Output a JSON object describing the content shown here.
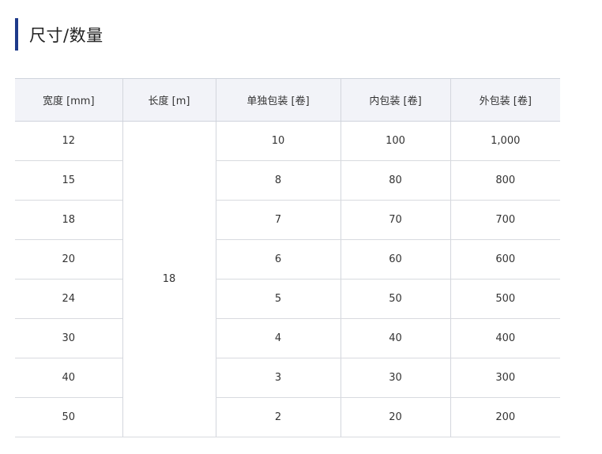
{
  "section": {
    "title": "尺寸/数量"
  },
  "table": {
    "headers": [
      "宽度 [mm]",
      "长度 [m]",
      "单独包装 [卷]",
      "内包装 [卷]",
      "外包装 [卷]"
    ],
    "length_merged": "18",
    "rows": [
      {
        "width": "12",
        "single": "10",
        "inner": "100",
        "outer": "1,000"
      },
      {
        "width": "15",
        "single": "8",
        "inner": "80",
        "outer": "800"
      },
      {
        "width": "18",
        "single": "7",
        "inner": "70",
        "outer": "700"
      },
      {
        "width": "20",
        "single": "6",
        "inner": "60",
        "outer": "600"
      },
      {
        "width": "24",
        "single": "5",
        "inner": "50",
        "outer": "500"
      },
      {
        "width": "30",
        "single": "4",
        "inner": "40",
        "outer": "400"
      },
      {
        "width": "40",
        "single": "3",
        "inner": "30",
        "outer": "300"
      },
      {
        "width": "50",
        "single": "2",
        "inner": "20",
        "outer": "200"
      }
    ]
  }
}
